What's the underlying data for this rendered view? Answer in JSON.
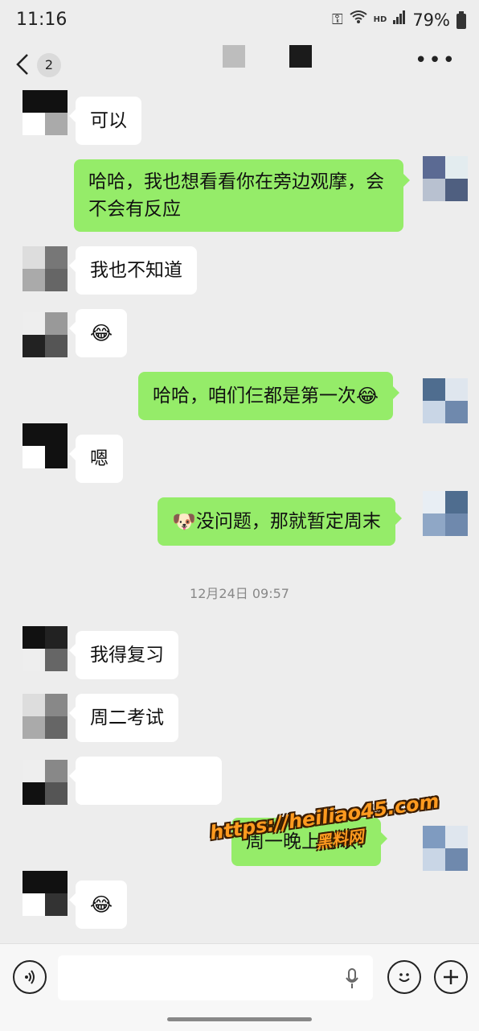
{
  "status_bar": {
    "time": "11:16",
    "network": "HD",
    "battery": "79%"
  },
  "header": {
    "unread_count": "2"
  },
  "messages": [
    {
      "text": "可以"
    },
    {
      "text": "哈哈，我也想看看你在旁边观摩，会不会有反应"
    },
    {
      "text": "我也不知道"
    },
    {
      "emoji": "😂"
    },
    {
      "text": "哈哈，咱们仨都是第一次",
      "emoji": "😂"
    },
    {
      "text": "嗯"
    },
    {
      "emoji": "🐶",
      "text": "没问题，那就暂定周末"
    },
    {
      "text": "我得复习"
    },
    {
      "text": "周二考试"
    },
    {
      "text": "周一晚上可以?"
    },
    {
      "emoji": "😂"
    }
  ],
  "timestamp": "12月24日 09:57",
  "watermark": {
    "line1": "https://heiliao45.com",
    "line2": "黑料网"
  },
  "icons": [
    "back-chevron",
    "more-dots",
    "voice",
    "mic",
    "emoji",
    "plus"
  ]
}
